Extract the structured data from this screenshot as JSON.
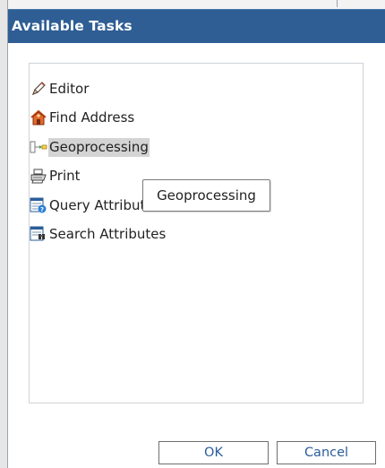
{
  "dialog": {
    "title": "Available Tasks",
    "title_bar_color": "#2f5e94"
  },
  "tasks": [
    {
      "label": "Editor",
      "icon": "pencil-icon"
    },
    {
      "label": "Find Address",
      "icon": "house-icon"
    },
    {
      "label": "Geoprocessing",
      "icon": "geoprocessing-icon",
      "hovered": true
    },
    {
      "label": "Print",
      "icon": "printer-icon"
    },
    {
      "label": "Query Attributes",
      "icon": "query-attributes-icon"
    },
    {
      "label": "Search Attributes",
      "icon": "search-attributes-icon"
    }
  ],
  "tooltip": {
    "text": "Geoprocessing"
  },
  "buttons": {
    "ok": "OK",
    "cancel": "Cancel",
    "accent_color": "#2a5d9a"
  }
}
